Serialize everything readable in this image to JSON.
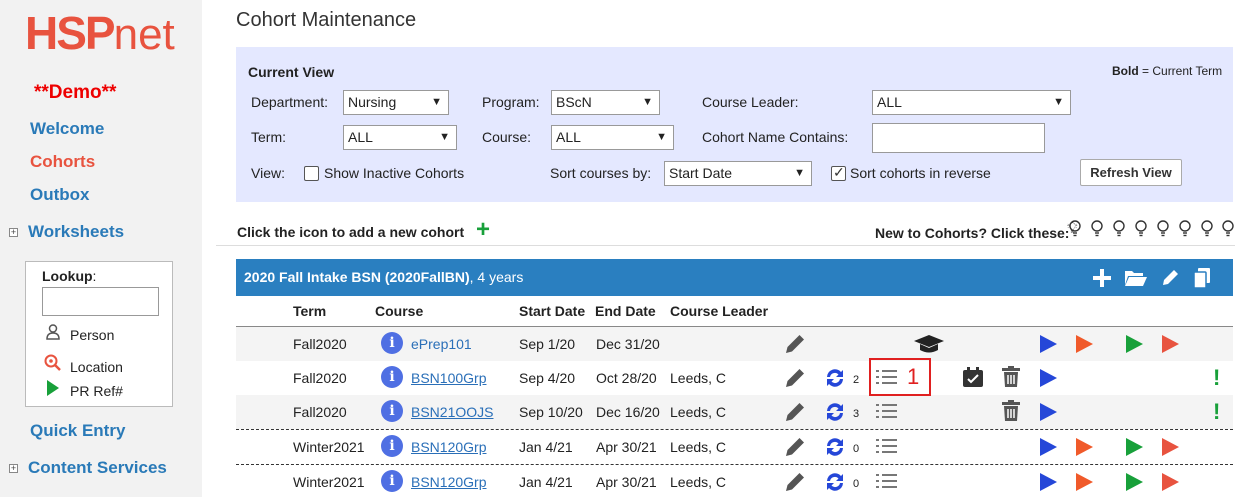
{
  "sidebar": {
    "logo_hsp": "HSP",
    "logo_net": "net",
    "demo": "**Demo**",
    "items": [
      {
        "label": "Welcome"
      },
      {
        "label": "Cohorts"
      },
      {
        "label": "Outbox"
      },
      {
        "label": "Worksheets"
      },
      {
        "label": "Quick Entry"
      },
      {
        "label": "Content Services"
      }
    ],
    "lookup": {
      "title": "Lookup",
      "person": "Person",
      "location": "Location",
      "prref": "PR Ref#"
    }
  },
  "page": {
    "title": "Cohort Maintenance"
  },
  "filters": {
    "heading": "Current View",
    "bold_note_b": "Bold",
    "bold_note": " = Current Term",
    "department_label": "Department:",
    "department_value": "Nursing",
    "program_label": "Program:",
    "program_value": "BScN",
    "course_leader_label": "Course Leader:",
    "course_leader_value": "ALL",
    "term_label": "Term:",
    "term_value": "ALL",
    "course_label": "Course:",
    "course_value": "ALL",
    "cohort_name_label": "Cohort Name Contains:",
    "cohort_name_value": "",
    "view_label": "View:",
    "show_inactive": "Show Inactive Cohorts",
    "sort_courses_label": "Sort courses by:",
    "sort_courses_value": "Start Date",
    "sort_reverse": "Sort cohorts in reverse",
    "refresh": "Refresh View"
  },
  "add": {
    "text": "Click the icon to add a new cohort",
    "new_to": "New to Cohorts? Click these:"
  },
  "cohort": {
    "title": "2020 Fall Intake BSN (2020FallBN)",
    "suffix": ", 4 years"
  },
  "columns": [
    "Term",
    "Course",
    "Start Date",
    "End Date",
    "Course Leader"
  ],
  "rows": [
    {
      "term": "Fall2020",
      "course": "ePrep101",
      "start": "Sep 1/20",
      "end": "Dec 31/20",
      "leader": "",
      "count": ""
    },
    {
      "term": "Fall2020",
      "course": "BSN100Grp",
      "start": "Sep 4/20",
      "end": "Oct 28/20",
      "leader": "Leeds, C",
      "count": "2"
    },
    {
      "term": "Fall2020",
      "course": "BSN21OOJS",
      "start": "Sep 10/20",
      "end": "Dec 16/20",
      "leader": "Leeds, C",
      "count": "3"
    },
    {
      "term": "Winter2021",
      "course": "BSN120Grp",
      "start": "Jan 4/21",
      "end": "Apr 30/21",
      "leader": "Leeds, C",
      "count": "0"
    },
    {
      "term": "Winter2021",
      "course": "BSN120Grp",
      "start": "Jan 4/21",
      "end": "Apr 30/21",
      "leader": "Leeds, C",
      "count": "0"
    }
  ],
  "annotation": "1",
  "colors": {
    "accent": "#e8533f",
    "link": "#2a7ab8",
    "band": "#2a7fc0"
  }
}
